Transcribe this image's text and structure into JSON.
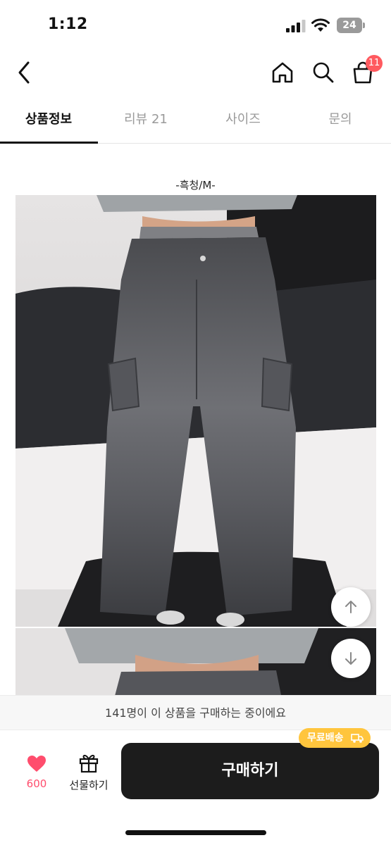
{
  "status_bar": {
    "time": "1:12",
    "battery_level": "24",
    "icons": [
      "signal-icon",
      "wifi-icon",
      "battery-icon"
    ]
  },
  "top_nav": {
    "icons": [
      "chevron-left-icon",
      "home-icon",
      "search-icon",
      "shopping-bag-icon"
    ],
    "cart_count": "11",
    "badge_color": "#ff5a5f"
  },
  "tabs": [
    {
      "label": "상품정보",
      "active": true
    },
    {
      "label": "리뷰 21",
      "active": false
    },
    {
      "label": "사이즈",
      "active": false
    },
    {
      "label": "문의",
      "active": false
    }
  ],
  "product_detail": {
    "option_caption": "-흑청/M-",
    "images": [
      "charcoal-wide-cargo-jeans-photo",
      "cargo-jeans-waist-photo"
    ],
    "scroll_buttons": [
      "arrow-up-icon",
      "arrow-down-icon"
    ]
  },
  "bottom_bar": {
    "purchase_notice": "141명이 이 상품을 구매하는 중이에요",
    "like_count": "600",
    "gift_label": "선물하기",
    "buy_label": "구매하기",
    "free_shipping_label": "무료배송",
    "colors": {
      "heart": "#ff4d6d",
      "badge": "#ffc53d",
      "button": "#1c1c1c"
    }
  }
}
